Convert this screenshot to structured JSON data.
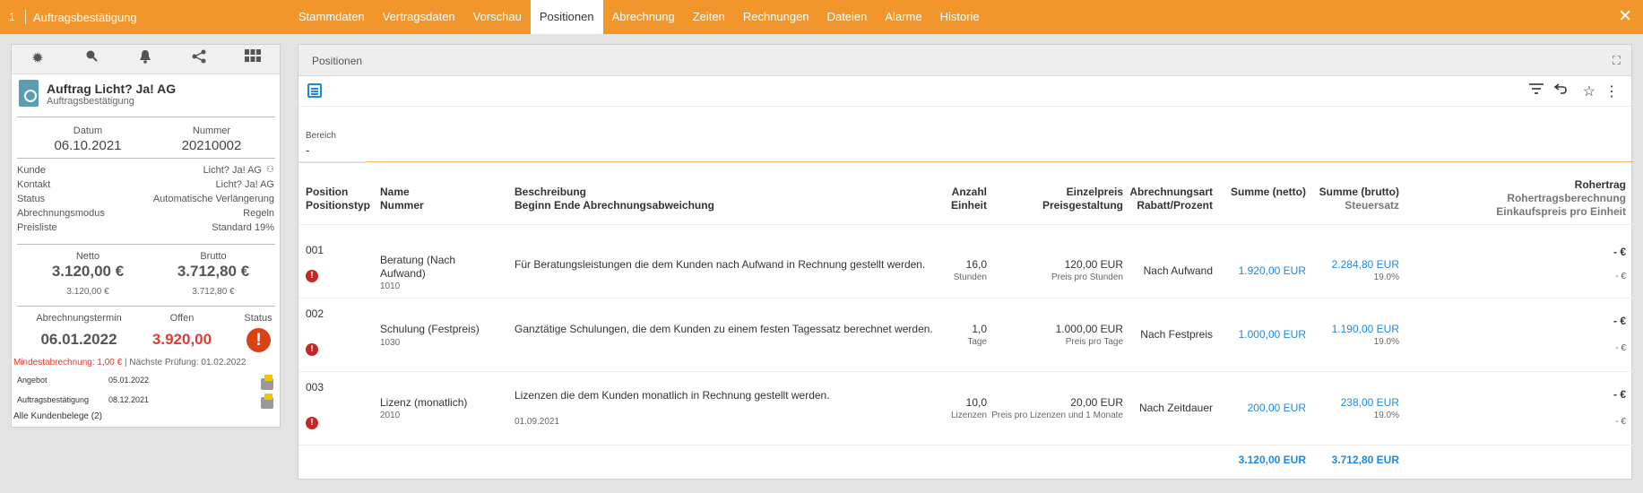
{
  "topbar": {
    "number": "1",
    "title": "Auftragsbestätigung",
    "tabs": [
      "Stammdaten",
      "Vertragsdaten",
      "Vorschau",
      "Positionen",
      "Abrechnung",
      "Zeiten",
      "Rechnungen",
      "Dateien",
      "Alarme",
      "Historie"
    ],
    "active_tab": "Positionen",
    "close": "✕"
  },
  "left": {
    "icons": [
      "settings-icon",
      "search-icon",
      "bell-icon",
      "share-icon",
      "apps-grid-icon"
    ],
    "doc_title": "Auftrag Licht? Ja! AG",
    "doc_subtitle": "Auftragsbestätigung",
    "datum_label": "Datum",
    "datum_value": "06.10.2021",
    "nummer_label": "Nummer",
    "nummer_value": "20210002",
    "fields": [
      {
        "label": "Kunde",
        "value": "Licht? Ja! AG"
      },
      {
        "label": "Kontakt",
        "value": "Licht? Ja! AG"
      },
      {
        "label": "Status",
        "value": "Automatische Verlängerung"
      },
      {
        "label": "Abrechnungsmodus",
        "value": "Regeln"
      },
      {
        "label": "Preisliste",
        "value": "Standard 19%"
      }
    ],
    "netto_label": "Netto",
    "netto_value": "3.120,00 €",
    "netto_small": "3.120,00 €",
    "brutto_label": "Brutto",
    "brutto_value": "3.712,80 €",
    "brutto_small": "3.712,80 €",
    "termin_label": "Abrechnungstermin",
    "termin_value": "06.01.2022",
    "offen_label": "Offen",
    "offen_value": "3.920,00",
    "status_label": "Status",
    "status_icon": "!",
    "mindest_text": "Mindestabrechnung: 1,00 €",
    "pruefung_text": "| Nächste Prüfung: 01.02.2022",
    "belege": [
      {
        "label": "Angebot",
        "date": "05.01.2022"
      },
      {
        "label": "Auftragsbestätigung",
        "date": "08.12.2021"
      }
    ],
    "alle_belege": "Alle Kundenbelege (2)"
  },
  "main": {
    "panel_title": "Positionen",
    "expand_icon": "⛶",
    "bereich_label": "Bereich",
    "bereich_value": "-",
    "headers": {
      "position": "Position",
      "positionstyp": "Positionstyp",
      "name": "Name",
      "nummer": "Nummer",
      "beschreibung": "Beschreibung",
      "beschreibung2": "Beginn Ende Abrechnungsabweichung",
      "anzahl": "Anzahl",
      "einheit": "Einheit",
      "einzelpreis": "Einzelpreis",
      "preisgestaltung": "Preisgestaltung",
      "abrechnungsart": "Abrechnungsart",
      "rabatt": "Rabatt/Prozent",
      "summe_netto": "Summe (netto)",
      "summe_brutto": "Summe (brutto)",
      "steuersatz": "Steuersatz",
      "rohertrag": "Rohertrag",
      "rohertragsberechnung": "Rohertragsberechnung",
      "einkaufspreis": "Einkaufspreis pro Einheit"
    },
    "rows": [
      {
        "pos": "001",
        "name": "Beratung (Nach",
        "name2": "Aufwand)",
        "nummer": "1010",
        "desc": "Für Beratungsleistungen die dem Kunden nach Aufwand in Rechnung gestellt werden.",
        "desc2": "",
        "anzahl": "16,0",
        "einheit": "Stunden",
        "preis": "120,00 EUR",
        "preis_sub": "Preis pro Stunden",
        "art": "Nach Aufwand",
        "netto": "1.920,00 EUR",
        "brutto": "2.284,80 EUR",
        "steuer": "19.0%",
        "ertrag": "- €",
        "ertrag_sub": "- €"
      },
      {
        "pos": "002",
        "name": "Schulung (Festpreis)",
        "name2": "",
        "nummer": "1030",
        "desc": "Ganztätige Schulungen, die dem Kunden zu einem festen Tagessatz berechnet werden.",
        "desc2": "",
        "anzahl": "1,0",
        "einheit": "Tage",
        "preis": "1.000,00 EUR",
        "preis_sub": "Preis pro Tage",
        "art": "Nach Festpreis",
        "netto": "1.000,00 EUR",
        "brutto": "1.190,00 EUR",
        "steuer": "19.0%",
        "ertrag": "- €",
        "ertrag_sub": "- €"
      },
      {
        "pos": "003",
        "name": "Lizenz (monatlich)",
        "name2": "",
        "nummer": "2010",
        "desc": "Lizenzen die dem Kunden monatlich in Rechnung gestellt werden.",
        "desc2": "01.09.2021",
        "anzahl": "10,0",
        "einheit": "Lizenzen",
        "preis": "20,00 EUR",
        "preis_sub": "Preis pro Lizenzen und 1 Monate",
        "art": "Nach Zeitdauer",
        "netto": "200,00 EUR",
        "brutto": "238,00 EUR",
        "steuer": "19.0%",
        "ertrag": "- €",
        "ertrag_sub": "- €"
      }
    ],
    "total_netto": "3.120,00 EUR",
    "total_brutto": "3.712,80 EUR"
  }
}
